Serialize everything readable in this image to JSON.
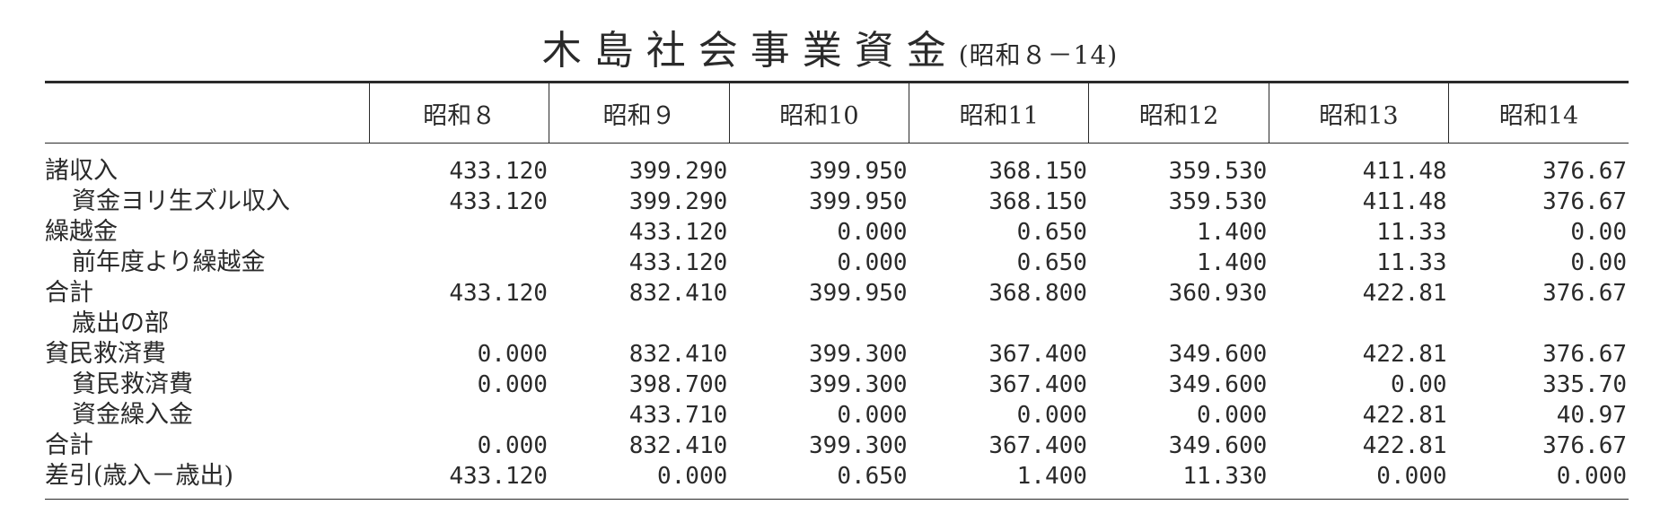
{
  "title": {
    "main": "木島社会事業資金",
    "sub": "(昭和８－14)"
  },
  "table": {
    "columns": [
      "昭和８",
      "昭和９",
      "昭和10",
      "昭和11",
      "昭和12",
      "昭和13",
      "昭和14"
    ],
    "rows": [
      {
        "label": "諸収入",
        "indent": false,
        "values": [
          "433.120",
          "399.290",
          "399.950",
          "368.150",
          "359.530",
          "411.48",
          "376.67"
        ]
      },
      {
        "label": "資金ヨリ生ズル収入",
        "indent": true,
        "values": [
          "433.120",
          "399.290",
          "399.950",
          "368.150",
          "359.530",
          "411.48",
          "376.67"
        ]
      },
      {
        "label": "繰越金",
        "indent": false,
        "values": [
          "",
          "433.120",
          "0.000",
          "0.650",
          "1.400",
          "11.33",
          "0.00"
        ]
      },
      {
        "label": "前年度より繰越金",
        "indent": true,
        "values": [
          "",
          "433.120",
          "0.000",
          "0.650",
          "1.400",
          "11.33",
          "0.00"
        ]
      },
      {
        "label": "合計",
        "indent": false,
        "values": [
          "433.120",
          "832.410",
          "399.950",
          "368.800",
          "360.930",
          "422.81",
          "376.67"
        ]
      },
      {
        "label": "歳出の部",
        "indent": true,
        "values": [
          "",
          "",
          "",
          "",
          "",
          "",
          ""
        ]
      },
      {
        "label": "貧民救済費",
        "indent": false,
        "values": [
          "0.000",
          "832.410",
          "399.300",
          "367.400",
          "349.600",
          "422.81",
          "376.67"
        ]
      },
      {
        "label": "貧民救済費",
        "indent": true,
        "values": [
          "0.000",
          "398.700",
          "399.300",
          "367.400",
          "349.600",
          "0.00",
          "335.70"
        ]
      },
      {
        "label": "資金繰入金",
        "indent": true,
        "values": [
          "",
          "433.710",
          "0.000",
          "0.000",
          "0.000",
          "422.81",
          "40.97"
        ]
      },
      {
        "label": "合計",
        "indent": false,
        "values": [
          "0.000",
          "832.410",
          "399.300",
          "367.400",
          "349.600",
          "422.81",
          "376.67"
        ]
      },
      {
        "label": "差引(歳入－歳出)",
        "indent": false,
        "values": [
          "433.120",
          "0.000",
          "0.650",
          "1.400",
          "11.330",
          "0.000",
          "0.000"
        ]
      }
    ]
  }
}
